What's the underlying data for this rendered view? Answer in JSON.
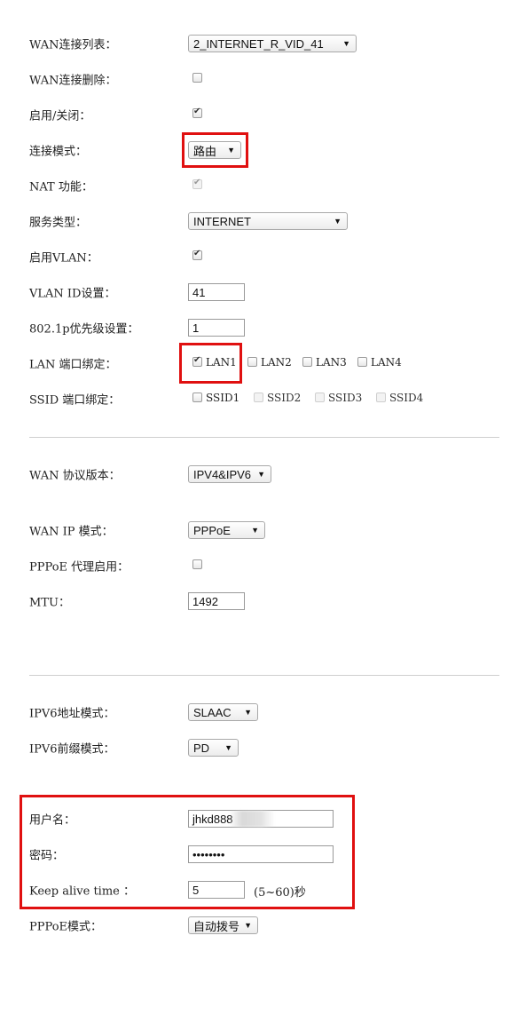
{
  "wan_list": {
    "label": "WAN连接列表：",
    "value": "2_INTERNET_R_VID_41"
  },
  "wan_delete": {
    "label": "WAN连接删除：",
    "checked": false
  },
  "enable": {
    "label": "启用/关闭：",
    "checked": true
  },
  "conn_mode": {
    "label": "连接模式：",
    "value": "路由"
  },
  "nat": {
    "label": "NAT 功能：",
    "checked": true
  },
  "service_type": {
    "label": "服务类型：",
    "value": "INTERNET"
  },
  "enable_vlan": {
    "label": "启用VLAN：",
    "checked": true
  },
  "vlan_id": {
    "label": "VLAN ID设置：",
    "value": "41"
  },
  "dot1p": {
    "label": "802.1p优先级设置：",
    "value": "1"
  },
  "lan_bind": {
    "label": "LAN 端口绑定：",
    "ports": [
      "LAN1",
      "LAN2",
      "LAN3",
      "LAN4"
    ]
  },
  "ssid_bind": {
    "label": "SSID 端口绑定：",
    "ports": [
      "SSID1",
      "SSID2",
      "SSID3",
      "SSID4"
    ]
  },
  "wan_protocol": {
    "label": "WAN 协议版本：",
    "value": "IPV4&IPV6"
  },
  "wan_ip_mode": {
    "label": "WAN IP 模式：",
    "value": "PPPoE"
  },
  "pppoe_proxy": {
    "label": "PPPoE 代理启用：",
    "checked": false
  },
  "mtu": {
    "label": "MTU：",
    "value": "1492"
  },
  "ipv6_addr_mode": {
    "label": "IPV6地址模式：",
    "value": "SLAAC"
  },
  "ipv6_prefix_mode": {
    "label": "IPV6前缀模式：",
    "value": "PD"
  },
  "username": {
    "label": "用户名：",
    "value": "jhkd888"
  },
  "password": {
    "label": "密码：",
    "value": "••••••••"
  },
  "keep_alive": {
    "label": "Keep alive time ：",
    "value": "5",
    "hint": "(5~60)秒"
  },
  "pppoe_mode": {
    "label": "PPPoE模式：",
    "value": "自动拨号"
  },
  "colors": {
    "highlight": "#e01010",
    "divider": "#cfcfcf"
  }
}
